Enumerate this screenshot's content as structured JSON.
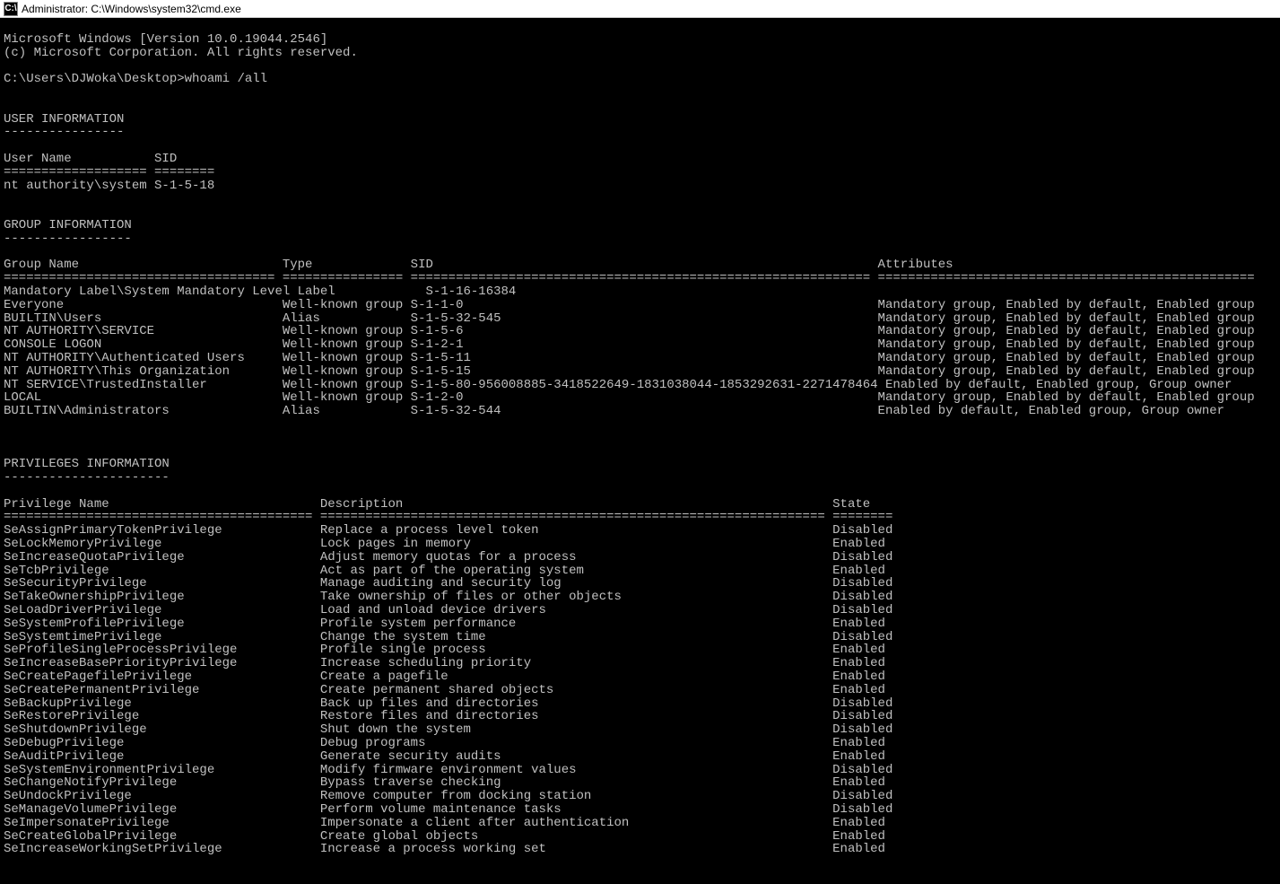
{
  "titlebar": {
    "icon_label": "C:\\",
    "title": "Administrator: C:\\Windows\\system32\\cmd.exe"
  },
  "header": {
    "line1": "Microsoft Windows [Version 10.0.19044.2546]",
    "line2": "(c) Microsoft Corporation. All rights reserved."
  },
  "prompt": {
    "path": "C:\\Users\\DJWoka\\Desktop>",
    "command": "whoami /all"
  },
  "user_info": {
    "heading": "USER INFORMATION",
    "heading_underline": "----------------",
    "col_user": "User Name",
    "col_sid": "SID",
    "sep_user": "===================",
    "sep_sid": "========",
    "user": "nt authority\\system",
    "sid": "S-1-5-18"
  },
  "group_info": {
    "heading": "GROUP INFORMATION",
    "heading_underline": "-----------------",
    "col_name": "Group Name",
    "col_type": "Type",
    "col_sid": "SID",
    "col_attr": "Attributes",
    "sep_name": "====================================",
    "sep_type": "================",
    "sep_sid": "=============================================================",
    "sep_attr": "==================================================",
    "rows": [
      {
        "name": "Mandatory Label\\System Mandatory Level",
        "type": "Label",
        "sid": "S-1-16-16384",
        "attr": ""
      },
      {
        "name": "Everyone",
        "type": "Well-known group",
        "sid": "S-1-1-0",
        "attr": "Mandatory group, Enabled by default, Enabled group"
      },
      {
        "name": "BUILTIN\\Users",
        "type": "Alias",
        "sid": "S-1-5-32-545",
        "attr": "Mandatory group, Enabled by default, Enabled group"
      },
      {
        "name": "NT AUTHORITY\\SERVICE",
        "type": "Well-known group",
        "sid": "S-1-5-6",
        "attr": "Mandatory group, Enabled by default, Enabled group"
      },
      {
        "name": "CONSOLE LOGON",
        "type": "Well-known group",
        "sid": "S-1-2-1",
        "attr": "Mandatory group, Enabled by default, Enabled group"
      },
      {
        "name": "NT AUTHORITY\\Authenticated Users",
        "type": "Well-known group",
        "sid": "S-1-5-11",
        "attr": "Mandatory group, Enabled by default, Enabled group"
      },
      {
        "name": "NT AUTHORITY\\This Organization",
        "type": "Well-known group",
        "sid": "S-1-5-15",
        "attr": "Mandatory group, Enabled by default, Enabled group"
      },
      {
        "name": "NT SERVICE\\TrustedInstaller",
        "type": "Well-known group",
        "sid": "S-1-5-80-956008885-3418522649-1831038044-1853292631-2271478464",
        "attr": "Enabled by default, Enabled group, Group owner"
      },
      {
        "name": "LOCAL",
        "type": "Well-known group",
        "sid": "S-1-2-0",
        "attr": "Mandatory group, Enabled by default, Enabled group"
      },
      {
        "name": "BUILTIN\\Administrators",
        "type": "Alias",
        "sid": "S-1-5-32-544",
        "attr": "Enabled by default, Enabled group, Group owner"
      }
    ]
  },
  "priv_info": {
    "heading": "PRIVILEGES INFORMATION",
    "heading_underline": "----------------------",
    "col_name": "Privilege Name",
    "col_desc": "Description",
    "col_state": "State",
    "sep_name": "=========================================",
    "sep_desc": "===================================================================",
    "sep_state": "========",
    "rows": [
      {
        "name": "SeAssignPrimaryTokenPrivilege",
        "desc": "Replace a process level token",
        "state": "Disabled"
      },
      {
        "name": "SeLockMemoryPrivilege",
        "desc": "Lock pages in memory",
        "state": "Enabled"
      },
      {
        "name": "SeIncreaseQuotaPrivilege",
        "desc": "Adjust memory quotas for a process",
        "state": "Disabled"
      },
      {
        "name": "SeTcbPrivilege",
        "desc": "Act as part of the operating system",
        "state": "Enabled"
      },
      {
        "name": "SeSecurityPrivilege",
        "desc": "Manage auditing and security log",
        "state": "Disabled"
      },
      {
        "name": "SeTakeOwnershipPrivilege",
        "desc": "Take ownership of files or other objects",
        "state": "Disabled"
      },
      {
        "name": "SeLoadDriverPrivilege",
        "desc": "Load and unload device drivers",
        "state": "Disabled"
      },
      {
        "name": "SeSystemProfilePrivilege",
        "desc": "Profile system performance",
        "state": "Enabled"
      },
      {
        "name": "SeSystemtimePrivilege",
        "desc": "Change the system time",
        "state": "Disabled"
      },
      {
        "name": "SeProfileSingleProcessPrivilege",
        "desc": "Profile single process",
        "state": "Enabled"
      },
      {
        "name": "SeIncreaseBasePriorityPrivilege",
        "desc": "Increase scheduling priority",
        "state": "Enabled"
      },
      {
        "name": "SeCreatePagefilePrivilege",
        "desc": "Create a pagefile",
        "state": "Enabled"
      },
      {
        "name": "SeCreatePermanentPrivilege",
        "desc": "Create permanent shared objects",
        "state": "Enabled"
      },
      {
        "name": "SeBackupPrivilege",
        "desc": "Back up files and directories",
        "state": "Disabled"
      },
      {
        "name": "SeRestorePrivilege",
        "desc": "Restore files and directories",
        "state": "Disabled"
      },
      {
        "name": "SeShutdownPrivilege",
        "desc": "Shut down the system",
        "state": "Disabled"
      },
      {
        "name": "SeDebugPrivilege",
        "desc": "Debug programs",
        "state": "Enabled"
      },
      {
        "name": "SeAuditPrivilege",
        "desc": "Generate security audits",
        "state": "Enabled"
      },
      {
        "name": "SeSystemEnvironmentPrivilege",
        "desc": "Modify firmware environment values",
        "state": "Disabled"
      },
      {
        "name": "SeChangeNotifyPrivilege",
        "desc": "Bypass traverse checking",
        "state": "Enabled"
      },
      {
        "name": "SeUndockPrivilege",
        "desc": "Remove computer from docking station",
        "state": "Disabled"
      },
      {
        "name": "SeManageVolumePrivilege",
        "desc": "Perform volume maintenance tasks",
        "state": "Disabled"
      },
      {
        "name": "SeImpersonatePrivilege",
        "desc": "Impersonate a client after authentication",
        "state": "Enabled"
      },
      {
        "name": "SeCreateGlobalPrivilege",
        "desc": "Create global objects",
        "state": "Enabled"
      },
      {
        "name": "SeIncreaseWorkingSetPrivilege",
        "desc": "Increase a process working set",
        "state": "Enabled"
      }
    ]
  }
}
